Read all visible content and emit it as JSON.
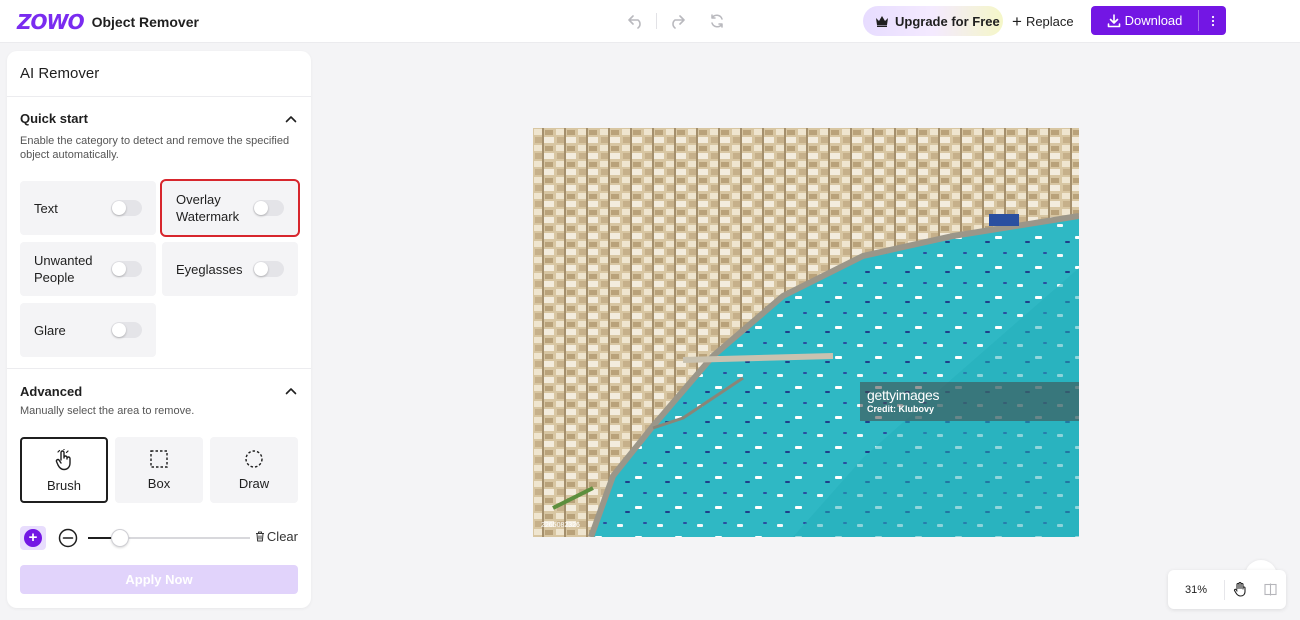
{
  "header": {
    "logo_text": "ZOWO",
    "app_name": "Object Remover",
    "upgrade_label": "Upgrade for Free",
    "replace_label": "Replace",
    "download_label": "Download"
  },
  "panel": {
    "title": "AI Remover",
    "quick_start": {
      "title": "Quick start",
      "description": "Enable the category to detect and remove the specified object automatically.",
      "categories": [
        {
          "label": "Text",
          "enabled": false
        },
        {
          "label": "Overlay Watermark",
          "enabled": false
        },
        {
          "label": "Unwanted People",
          "enabled": false
        },
        {
          "label": "Eyeglasses",
          "enabled": false
        },
        {
          "label": "Glare",
          "enabled": false
        }
      ]
    },
    "advanced": {
      "title": "Advanced",
      "description": "Manually select the area to remove.",
      "tools": [
        {
          "label": "Brush",
          "active": true
        },
        {
          "label": "Box",
          "active": false
        },
        {
          "label": "Draw",
          "active": false
        }
      ],
      "brush_size": 0.2,
      "clear_label": "Clear"
    },
    "apply_label": "Apply Now"
  },
  "canvas": {
    "watermark_brand": "gettyimages",
    "watermark_credit": "Credit: Klubovy",
    "image_id": "2265082326"
  },
  "zoom": {
    "value": "31%"
  },
  "colors": {
    "brand": "#7316e4",
    "highlight": "#d7262d",
    "sea": "#2fb8c4"
  }
}
